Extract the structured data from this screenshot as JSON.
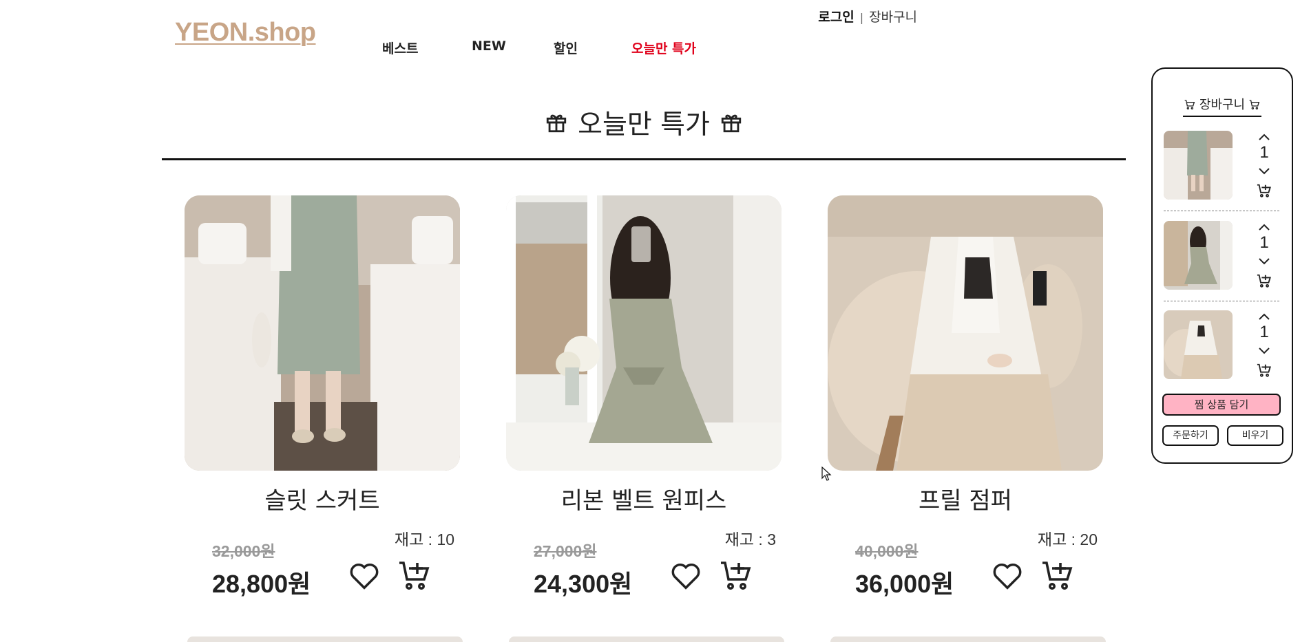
{
  "header": {
    "logo": "YEON.shop",
    "login": "로그인",
    "separator": "|",
    "cart_link": "장바구니",
    "menu": [
      {
        "label": "베스트"
      },
      {
        "label": "NEW"
      },
      {
        "label": "할인"
      },
      {
        "label": "오늘만 특가"
      }
    ]
  },
  "section": {
    "title": "오늘만 특가",
    "icon": "gift-icon"
  },
  "products": [
    {
      "name": "슬릿 스커트",
      "stock": "재고 : 10",
      "original_price": "32,000원",
      "price": "28,800원"
    },
    {
      "name": "리본 벨트 원피스",
      "stock": "재고 : 3",
      "original_price": "27,000원",
      "price": "24,300원"
    },
    {
      "name": "프릴 점퍼",
      "stock": "재고 : 20",
      "original_price": "40,000원",
      "price": "36,000원"
    }
  ],
  "side_cart": {
    "title": "장바구니",
    "items": [
      {
        "qty": "1"
      },
      {
        "qty": "1"
      },
      {
        "qty": "1"
      }
    ],
    "wishlist_button": "찜 상품 담기",
    "order_button": "주문하기",
    "clear_button": "비우기"
  },
  "colors": {
    "logo": "#c8a587",
    "special_menu": "#e0001a",
    "wishlist_button": "#ffb3c4"
  }
}
